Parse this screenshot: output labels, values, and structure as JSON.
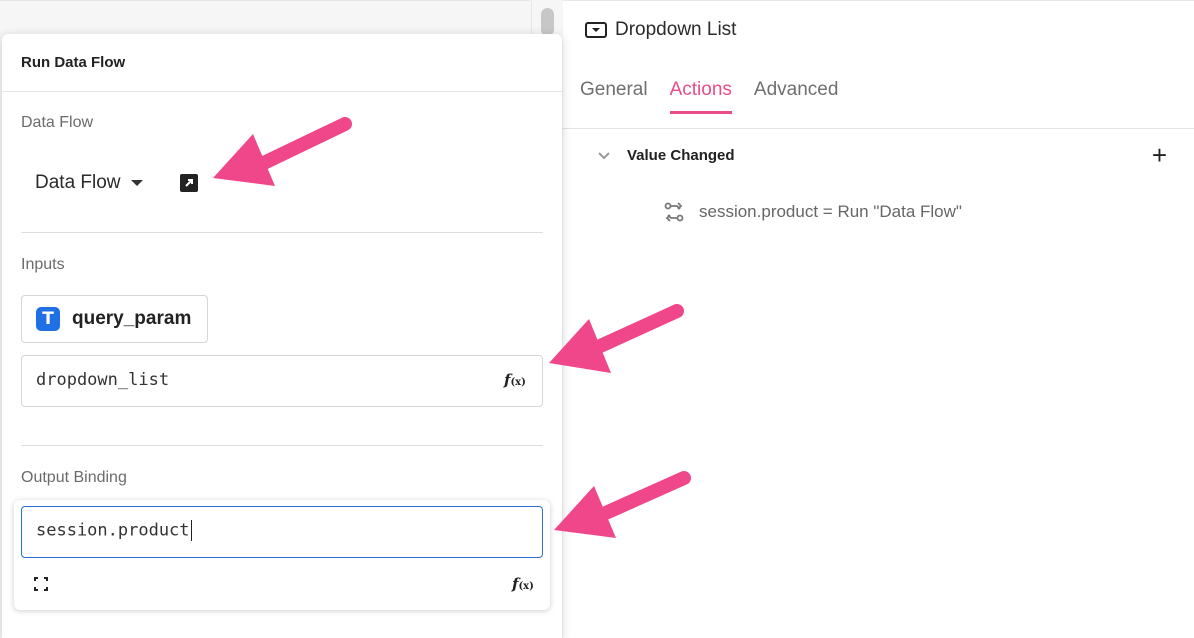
{
  "right_panel": {
    "component_icon": "dropdown-icon",
    "title": "Dropdown List",
    "tabs": [
      {
        "label": "General",
        "active": false
      },
      {
        "label": "Actions",
        "active": true
      },
      {
        "label": "Advanced",
        "active": false
      }
    ],
    "event": {
      "name": "Value Changed",
      "add_icon": "plus-icon",
      "collapse_icon": "chevron-down-icon",
      "action": {
        "icon": "data-flow-icon",
        "text": "session.product = Run \"Data Flow\""
      }
    }
  },
  "run_data_flow": {
    "title": "Run Data Flow",
    "data_flow": {
      "label": "Data Flow",
      "selected": "Data Flow",
      "open_icon": "open-external-icon"
    },
    "inputs": {
      "label": "Inputs",
      "param_type_icon": "T",
      "param_name": "query_param",
      "value": "dropdown_list",
      "fx_label": "f",
      "fx_sub": "(x)"
    },
    "output_binding": {
      "label": "Output Binding",
      "value": "session.product",
      "expand_icon": "expand-icon",
      "fx_label": "f",
      "fx_sub": "(x)"
    }
  },
  "annotations": {
    "arrow_color": "#f0468a"
  }
}
